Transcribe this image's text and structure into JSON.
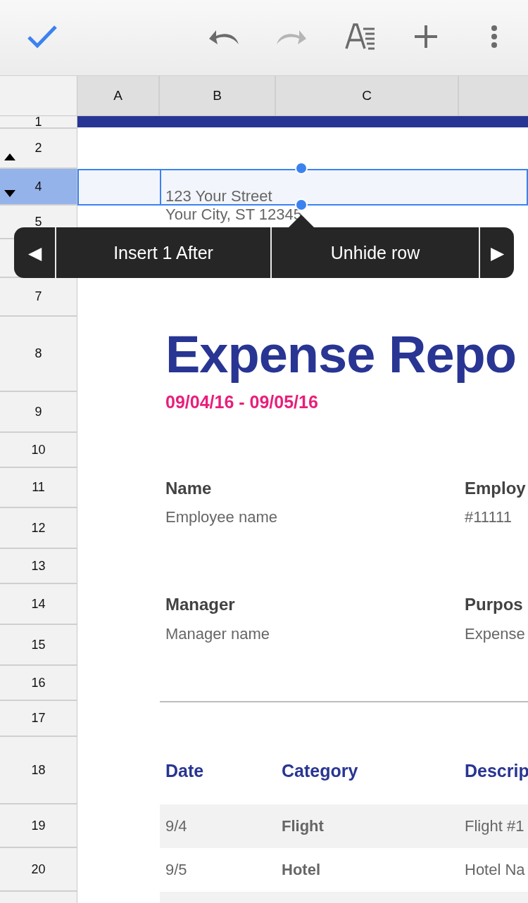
{
  "toolbar": {
    "actions": [
      {
        "kind": "done",
        "disabled": false
      },
      {
        "kind": "undo",
        "disabled": false
      },
      {
        "kind": "redo",
        "disabled": true
      },
      {
        "kind": "format",
        "disabled": false
      },
      {
        "kind": "add",
        "disabled": false
      },
      {
        "kind": "more",
        "disabled": false
      }
    ]
  },
  "columns": [
    "A",
    "B",
    "C"
  ],
  "rows": [
    {
      "label": "1",
      "selected": false
    },
    {
      "label": "2",
      "selected": false,
      "kind": "hidden_below"
    },
    {
      "label": "4",
      "selected": true,
      "kind": "hidden_above"
    },
    {
      "label": "5",
      "selected": false
    },
    {
      "selected": false
    },
    {
      "label": "7",
      "selected": false
    },
    {
      "label": "8",
      "selected": false
    },
    {
      "label": "9",
      "selected": false
    },
    {
      "label": "10",
      "selected": false
    },
    {
      "label": "11",
      "selected": false
    },
    {
      "label": "12",
      "selected": false
    },
    {
      "label": "13",
      "selected": false
    },
    {
      "label": "14",
      "selected": false
    },
    {
      "label": "15",
      "selected": false
    },
    {
      "label": "16",
      "selected": false
    },
    {
      "label": "17",
      "selected": false
    },
    {
      "label": "18",
      "selected": false
    },
    {
      "label": "19",
      "selected": false
    },
    {
      "label": "20",
      "selected": false
    },
    {
      "selected": false
    }
  ],
  "document": {
    "address": [
      "123 Your Street",
      "Your City, ST 12345"
    ],
    "title": "Expense Repo",
    "dates": "09/04/16 - 09/05/16",
    "fields": [
      {
        "label": "Name",
        "value": "Employee name"
      },
      {
        "label": "Employ",
        "value": "#11111"
      },
      {
        "label": "Manager",
        "value": "Manager name"
      },
      {
        "label": "Purpos",
        "value": "Expense"
      }
    ],
    "table": {
      "columns": [
        "Date",
        "Category",
        "Descrip"
      ],
      "rows": [
        [
          "9/4",
          "Flight",
          "Flight #1"
        ],
        [
          "9/5",
          "Hotel",
          "Hotel Na"
        ]
      ]
    }
  },
  "popup": {
    "prev": "◀",
    "items": [
      "Insert 1 After",
      "Unhide row"
    ],
    "next": "▶"
  }
}
